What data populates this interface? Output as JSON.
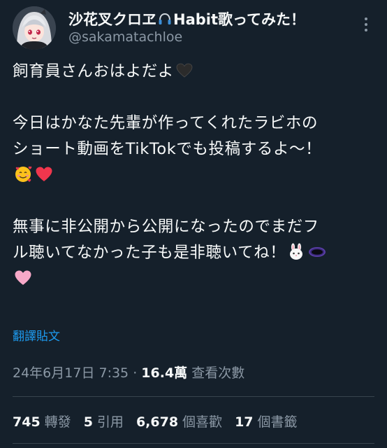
{
  "author": {
    "display_name_part1": "沙花叉クロヱ",
    "display_name_part2": "Habit歌ってみた！",
    "handle": "@sakamatachloe",
    "name_icon": "headphones-icon"
  },
  "tweet": {
    "line1": "飼育員さんおはよだよ",
    "line2": "今日はかなた先輩が作ってくれたラビホの",
    "line3": "ショート動画をTikTokでも投稿するよ〜！",
    "line5": "無事に非公開から公開になったのでまだフ",
    "line6": "ル聴いてなかった子も是非聴いてね！",
    "emojis": [
      "black-heart",
      "smiling-face-with-hearts",
      "red-heart",
      "rabbit-face",
      "black-hole",
      "pink-heart"
    ]
  },
  "translate_label": "翻譯貼文",
  "meta": {
    "date": "24年6月17日 7:35",
    "separator": "·",
    "views": "16.4萬",
    "views_label": "查看次數"
  },
  "stats": {
    "reposts": "745",
    "reposts_label": "轉發",
    "quotes": "5",
    "quotes_label": "引用",
    "likes": "6,678",
    "likes_label": "個喜歡",
    "bookmarks": "17",
    "bookmarks_label": "個書籤"
  },
  "colors": {
    "background": "#15202b",
    "text": "#f7f9f9",
    "secondary": "#8b98a5",
    "link": "#1d9bf0",
    "divider": "#38444d"
  }
}
